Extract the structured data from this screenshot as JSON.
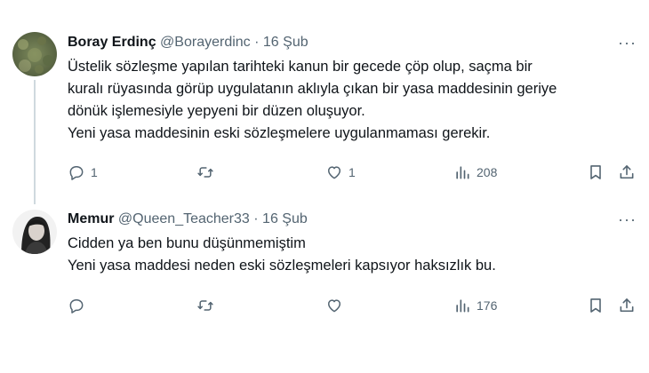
{
  "tweets": [
    {
      "author_name": "Boray Erdinç",
      "handle": "@Borayerdinc",
      "separator": "·",
      "date": "16 Şub",
      "more_label": "···",
      "lines": [
        "Üstelik sözleşme yapılan tarihteki kanun bir gecede çöp olup, saçma bir",
        "kuralı rüyasında görüp uygulatanın aklıyla çıkan bir yasa maddesinin geriye",
        "dönük işlemesiyle yepyeni bir düzen oluşuyor.",
        "Yeni yasa maddesinin eski sözleşmelere uygulanmaması gerekir."
      ],
      "replies": "1",
      "retweets": "",
      "likes": "1",
      "views": "208"
    },
    {
      "author_name": "Memur",
      "handle": "@Queen_Teacher33",
      "separator": "·",
      "date": "16 Şub",
      "more_label": "···",
      "lines": [
        "Cidden ya ben bunu düşünmemiştim",
        "Yeni yasa maddesi neden eski sözleşmeleri kapsıyor haksızlık bu."
      ],
      "replies": "",
      "retweets": "",
      "likes": "",
      "views": "176"
    }
  ],
  "colors": {
    "text": "#0f1419",
    "secondary": "#536471",
    "thread_line": "#cfd9de"
  },
  "icons": [
    "reply-icon",
    "retweet-icon",
    "like-icon",
    "views-icon",
    "bookmark-icon",
    "share-icon"
  ]
}
